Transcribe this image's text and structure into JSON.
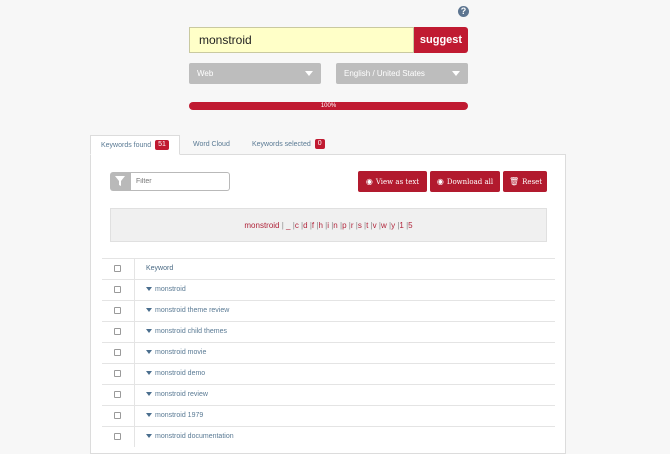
{
  "search": {
    "query": "monstroid",
    "suggest_label": "suggest"
  },
  "filters": {
    "source": "Web",
    "language": "English / United States"
  },
  "progress": {
    "label": "100%",
    "percent": 100
  },
  "tabs": [
    {
      "label": "Keywords found",
      "count": "51"
    },
    {
      "label": "Word Cloud"
    },
    {
      "label": "Keywords selected",
      "count": "0"
    }
  ],
  "toolbar": {
    "filter_placeholder": "Filter",
    "view_as_text": "View as text",
    "download_all": "Download all",
    "reset": "Reset"
  },
  "alphabet": {
    "prefix": "monstroid",
    "letters": [
      "_",
      "c",
      "d",
      "f",
      "h",
      "i",
      "n",
      "p",
      "r",
      "s",
      "t",
      "v",
      "w",
      "y",
      "1",
      "5"
    ]
  },
  "table": {
    "header": "Keyword",
    "rows": [
      "monstroid",
      "monstroid theme review",
      "monstroid child themes",
      "monstroid movie",
      "monstroid demo",
      "monstroid review",
      "monstroid 1979",
      "monstroid documentation"
    ]
  },
  "colors": {
    "accent": "#c01a31",
    "input_bg": "#ffffc8",
    "link": "#5a7a94"
  }
}
